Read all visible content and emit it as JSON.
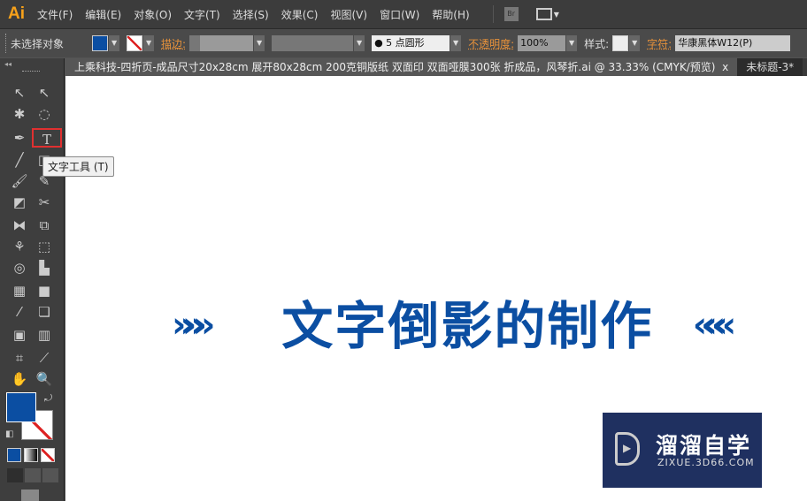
{
  "app": {
    "logo": "Ai"
  },
  "menu": [
    "文件(F)",
    "编辑(E)",
    "对象(O)",
    "文字(T)",
    "选择(S)",
    "效果(C)",
    "视图(V)",
    "窗口(W)",
    "帮助(H)"
  ],
  "menubar_extra": {
    "bridge": "Br"
  },
  "control": {
    "selection": "未选择对象",
    "stroke_label": "描边:",
    "brush": "5 点圆形",
    "opacity_label": "不透明度:",
    "opacity": "100%",
    "style_label": "样式:",
    "char_label": "字符:",
    "font": "华康黑体W12(P)"
  },
  "tabs": [
    {
      "label": "上乘科技-四折页-成品尺寸20x28cm  展开80x28cm  200克铜版纸  双面印 双面哑膜300张 折成品，风琴折.ai @ 33.33% (CMYK/预览)",
      "close": "x"
    },
    {
      "label": "未标题-3*"
    }
  ],
  "tooltip": "文字工具 (T)",
  "colors": {
    "fill": "#0b4ea2",
    "accent": "#f7a11a"
  },
  "canvas": {
    "headline": "文字倒影的制作",
    "left_deco": "»»»",
    "right_deco": "«««"
  },
  "watermark": {
    "name": "溜溜自学",
    "url": "ZIXUE.3D66.COM"
  }
}
